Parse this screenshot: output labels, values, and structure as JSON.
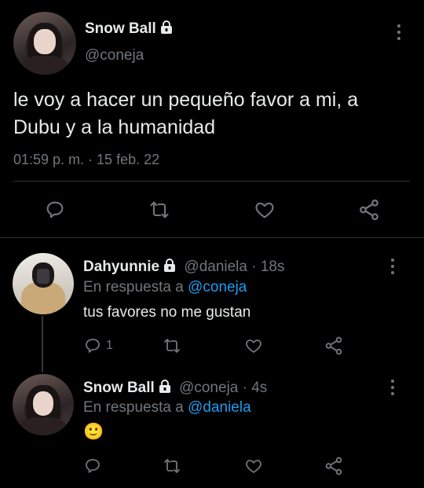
{
  "main_tweet": {
    "display_name": "Snow Ball",
    "handle": "@coneja",
    "text_line1": "le voy a hacer un pequeño favor a mi, a",
    "text_line2": "Dubu y a la humanidad",
    "timestamp": "01:59 p. m. · 15 feb. 22"
  },
  "replies": [
    {
      "display_name": "Dahyunnie",
      "handle_time": "@daniela · 18s",
      "reply_prefix": "En respuesta a",
      "reply_to": "@coneja",
      "text": "tus favores no me gustan",
      "reply_count": "1"
    },
    {
      "display_name": "Snow Ball",
      "handle_time": "@coneja · 4s",
      "reply_prefix": "En respuesta a",
      "reply_to": "@daniela",
      "text": "🙂"
    }
  ],
  "icons": [
    "lock-icon",
    "more-icon",
    "reply-icon",
    "retweet-icon",
    "like-icon",
    "share-icon"
  ],
  "colors": {
    "background": "#000000",
    "text": "#e7e9ea",
    "muted": "#71767b",
    "link": "#1d9bf0",
    "divider": "#2f3336"
  }
}
